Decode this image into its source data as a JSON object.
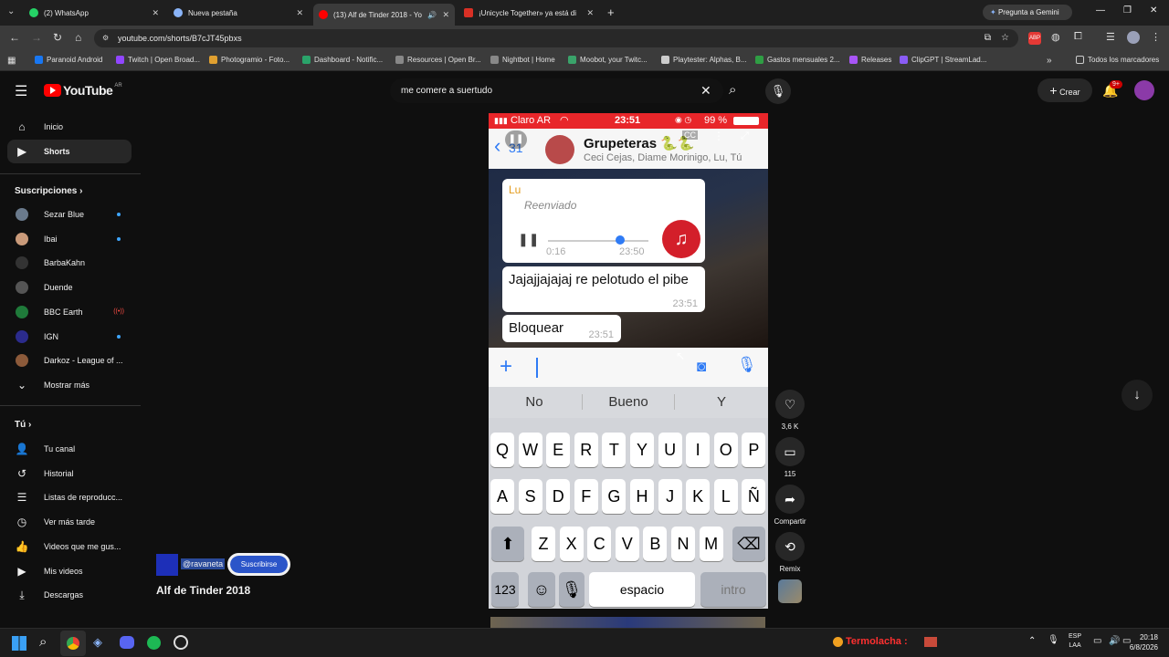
{
  "tabs": [
    {
      "title": "(2) WhatsApp",
      "fav": "#25d366"
    },
    {
      "title": "Nueva pestaña",
      "fav": "#8ab4f8"
    },
    {
      "title": "(13) Alf de Tinder 2018 - Yo",
      "fav": "#ff0000"
    },
    {
      "title": "¡Unicycle Together» ya está di",
      "fav": "#d93025"
    }
  ],
  "gemini_label": "Pregunta a Gemini",
  "url": "youtube.com/shorts/B7cJT45pbxs",
  "bookmarks": [
    "Paranoid Android",
    "Twitch | Open Broad...",
    "Photogramio - Foto...",
    "Dashboard - Notific...",
    "Resources | Open Br...",
    "Nightbot | Home",
    "Moobot, your Twitc...",
    "Playtester: Alphas, B...",
    "Gastos mensuales 2...",
    "Releases",
    "ClipGPT | StreamLad..."
  ],
  "bookmarks_all": "Todos los marcadores",
  "yt": {
    "logo": "YouTube",
    "region": "AR",
    "search_value": "me comere a suertudo",
    "create": "Crear",
    "notif_count": "9+"
  },
  "sidebar": {
    "home": "Inicio",
    "shorts": "Shorts",
    "subs_head": "Suscripciones",
    "subs": [
      {
        "name": "Sezar Blue",
        "color": "#6a7a8c",
        "live": "dot"
      },
      {
        "name": "Ibai",
        "color": "#c99a7a",
        "live": "dot"
      },
      {
        "name": "BarbaKahn",
        "color": "#333333",
        "live": ""
      },
      {
        "name": "Duende",
        "color": "#555555",
        "live": ""
      },
      {
        "name": "BBC Earth",
        "color": "#1f7a3a",
        "live": "live"
      },
      {
        "name": "IGN",
        "color": "#2b2b8c",
        "live": "dot"
      },
      {
        "name": "Darkoz - League of ...",
        "color": "#8c5a3a",
        "live": ""
      }
    ],
    "more": "Mostrar más",
    "you_head": "Tú",
    "you": [
      {
        "label": "Tu canal",
        "icon": "person-icon",
        "glyph": "👤"
      },
      {
        "label": "Historial",
        "icon": "history-icon",
        "glyph": "↺"
      },
      {
        "label": "Listas de reproducc...",
        "icon": "playlist-icon",
        "glyph": "☰"
      },
      {
        "label": "Ver más tarde",
        "icon": "clock-icon",
        "glyph": "◷"
      },
      {
        "label": "Videos que me gus...",
        "icon": "like-icon",
        "glyph": "👍"
      },
      {
        "label": "Mis videos",
        "icon": "video-icon",
        "glyph": "▶"
      },
      {
        "label": "Descargas",
        "icon": "download-icon",
        "glyph": "⤓"
      }
    ]
  },
  "short": {
    "channel": "@ravaneta",
    "subscribe": "Suscribirse",
    "title": "Alf de Tinder 2018",
    "likes": "3,6 K",
    "comments": "115",
    "share": "Compartir",
    "remix": "Remix"
  },
  "phone": {
    "carrier": "Claro AR",
    "time": "23:51",
    "battery": "99 %",
    "back_count": "31",
    "group": "Grupeteras 🐍🐍",
    "members": "Ceci Cejas, Diame Morinigo, Lu, Tú",
    "sender": "Lu",
    "forwarded": "Reenviado",
    "audio_elapsed": "0:16",
    "audio_time": "23:50",
    "msg1": "Jajajjajajaj re pelotudo el pibe",
    "msg1_time": "23:51",
    "msg2": "Bloquear",
    "msg2_time": "23:51",
    "suggestions": [
      "No",
      "Bueno",
      "Y"
    ],
    "row1": [
      "Q",
      "W",
      "E",
      "R",
      "T",
      "Y",
      "U",
      "I",
      "O",
      "P"
    ],
    "row2": [
      "A",
      "S",
      "D",
      "F",
      "G",
      "H",
      "J",
      "K",
      "L",
      "Ñ"
    ],
    "row3": [
      "Z",
      "X",
      "C",
      "V",
      "B",
      "N",
      "M"
    ],
    "num_key": "123",
    "space": "espacio",
    "enter": "intro"
  },
  "taskbar": {
    "stream_text": "Termolacha :",
    "lang": "ESP",
    "lang2": "LAA",
    "time": "20:18",
    "date": "6/8/2026"
  }
}
